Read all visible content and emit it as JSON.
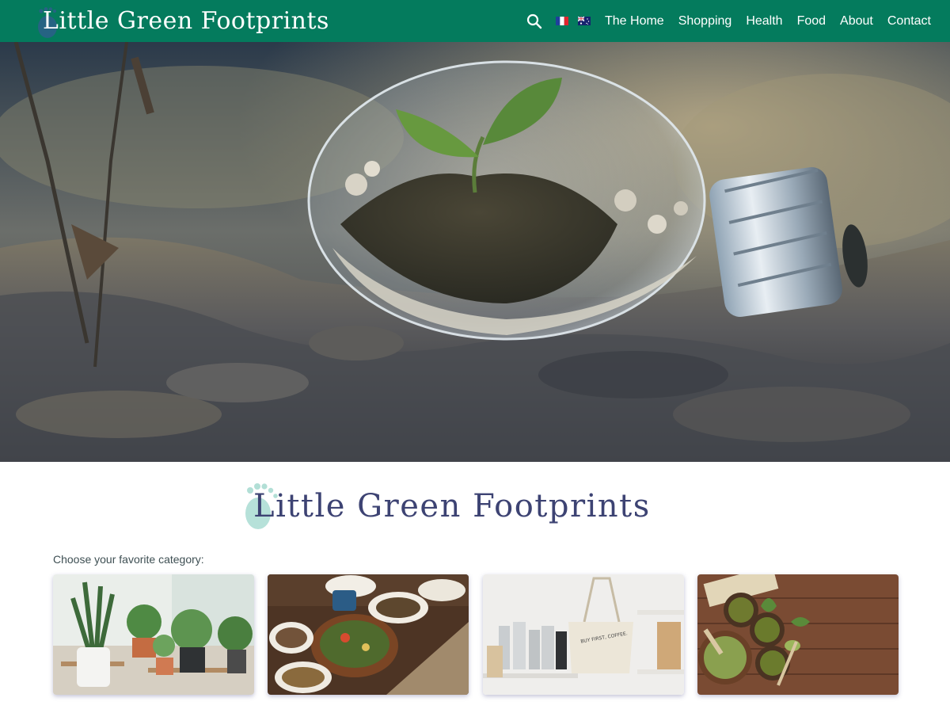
{
  "site": {
    "title": "Little Green Footprints",
    "brand_color": "#047b5d",
    "logo_text_color": "#3d4373"
  },
  "header": {
    "search_icon": "search-icon",
    "languages": [
      {
        "name": "French",
        "icon": "flag-fr-icon"
      },
      {
        "name": "Australian English",
        "icon": "flag-au-icon"
      }
    ],
    "nav": [
      {
        "label": "The Home"
      },
      {
        "label": "Shopping"
      },
      {
        "label": "Health"
      },
      {
        "label": "Food"
      },
      {
        "label": "About"
      },
      {
        "label": "Contact"
      }
    ]
  },
  "main": {
    "logo_text": "Little Green Footprints",
    "category_prompt": "Choose your favorite category:",
    "categories": [
      {
        "image": "houseplants"
      },
      {
        "image": "food-bowls"
      },
      {
        "image": "tote-bag-and-jars"
      },
      {
        "image": "matcha-tea"
      }
    ]
  }
}
